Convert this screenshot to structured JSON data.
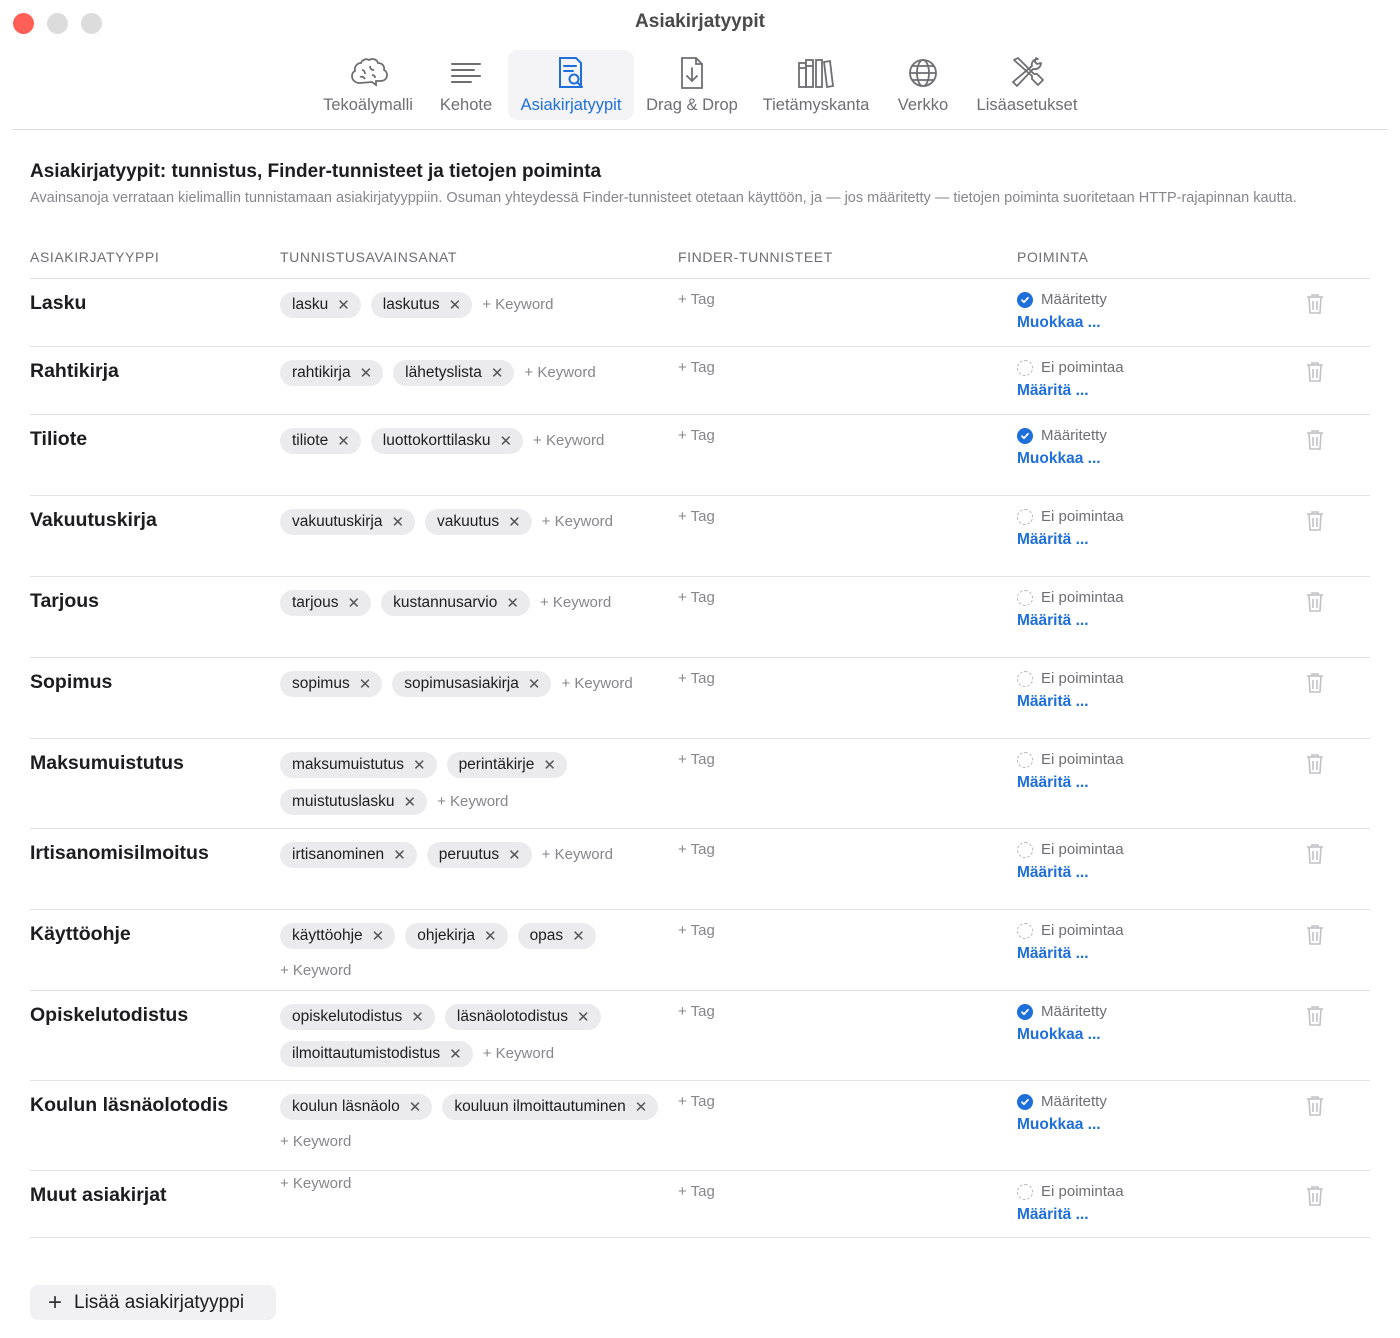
{
  "window": {
    "title": "Asiakirjatyypit"
  },
  "toolbar": {
    "items": [
      {
        "label": "Tekoälymalli",
        "icon": "brain-icon"
      },
      {
        "label": "Kehote",
        "icon": "text-lines-icon"
      },
      {
        "label": "Asiakirjatyypit",
        "icon": "document-search-icon",
        "active": true
      },
      {
        "label": "Drag & Drop",
        "icon": "document-download-icon"
      },
      {
        "label": "Tietämyskanta",
        "icon": "books-icon"
      },
      {
        "label": "Verkko",
        "icon": "globe-icon"
      },
      {
        "label": "Lisäasetukset",
        "icon": "tools-icon"
      }
    ]
  },
  "header": {
    "title": "Asiakirjatyypit: tunnistus, Finder-tunnisteet ja tietojen poiminta",
    "description": "Avainsanoja verrataan kielimallin tunnistamaan asiakirjatyyppiin. Osuman yhteydessä Finder-tunnisteet otetaan käyttöön, ja — jos määritetty — tietojen poiminta suoritetaan HTTP-rajapinnan kautta."
  },
  "columns": {
    "type": "ASIAKIRJATYYPPI",
    "keywords": "TUNNISTUSAVAINSANAT",
    "tags": "FINDER-TUNNISTEET",
    "extraction": "POIMINTA"
  },
  "labels": {
    "add_keyword": "+ Keyword",
    "add_tag": "+ Tag",
    "remove_glyph": "✕",
    "status_defined": "Määritetty",
    "status_none": "Ei poimintaa",
    "action_edit": "Muokkaa ...",
    "action_define": "Määritä ..."
  },
  "rows": [
    {
      "name": "Lasku",
      "keywords": [
        "lasku",
        "laskutus"
      ],
      "defined": true
    },
    {
      "name": "Rahtikirja",
      "keywords": [
        "rahtikirja",
        "lähetyslista"
      ],
      "defined": false
    },
    {
      "name": "Tiliote",
      "keywords": [
        "tiliote",
        "luottokorttilasku"
      ],
      "defined": true
    },
    {
      "name": "Vakuutuskirja",
      "keywords": [
        "vakuutuskirja",
        "vakuutus"
      ],
      "defined": false
    },
    {
      "name": "Tarjous",
      "keywords": [
        "tarjous",
        "kustannusarvio"
      ],
      "defined": false
    },
    {
      "name": "Sopimus",
      "keywords": [
        "sopimus",
        "sopimusasiakirja"
      ],
      "defined": false
    },
    {
      "name": "Maksumuistutus",
      "keywords": [
        "maksumuistutus",
        "perintäkirje",
        "muistutuslasku"
      ],
      "defined": false
    },
    {
      "name": "Irtisanomisilmoitus",
      "keywords": [
        "irtisanominen",
        "peruutus"
      ],
      "defined": false
    },
    {
      "name": "Käyttöohje",
      "keywords": [
        "käyttöohje",
        "ohjekirja",
        "opas"
      ],
      "defined": false
    },
    {
      "name": "Opiskelutodistus",
      "keywords": [
        "opiskelutodistus",
        "läsnäolotodistus",
        "ilmoittautumistodistus"
      ],
      "defined": true
    },
    {
      "name": "Koulun läsnäolotodis",
      "keywords": [
        "koulun läsnäolo",
        "kouluun ilmoittautuminen"
      ],
      "defined": true
    },
    {
      "name": "Muut asiakirjat",
      "keywords": [],
      "defined": false
    }
  ],
  "footer": {
    "add_button": "Lisää asiakirjatyyppi",
    "add_icon": "plus-icon"
  },
  "colors": {
    "accent": "#1e6fd9",
    "close": "#fe5f57"
  }
}
